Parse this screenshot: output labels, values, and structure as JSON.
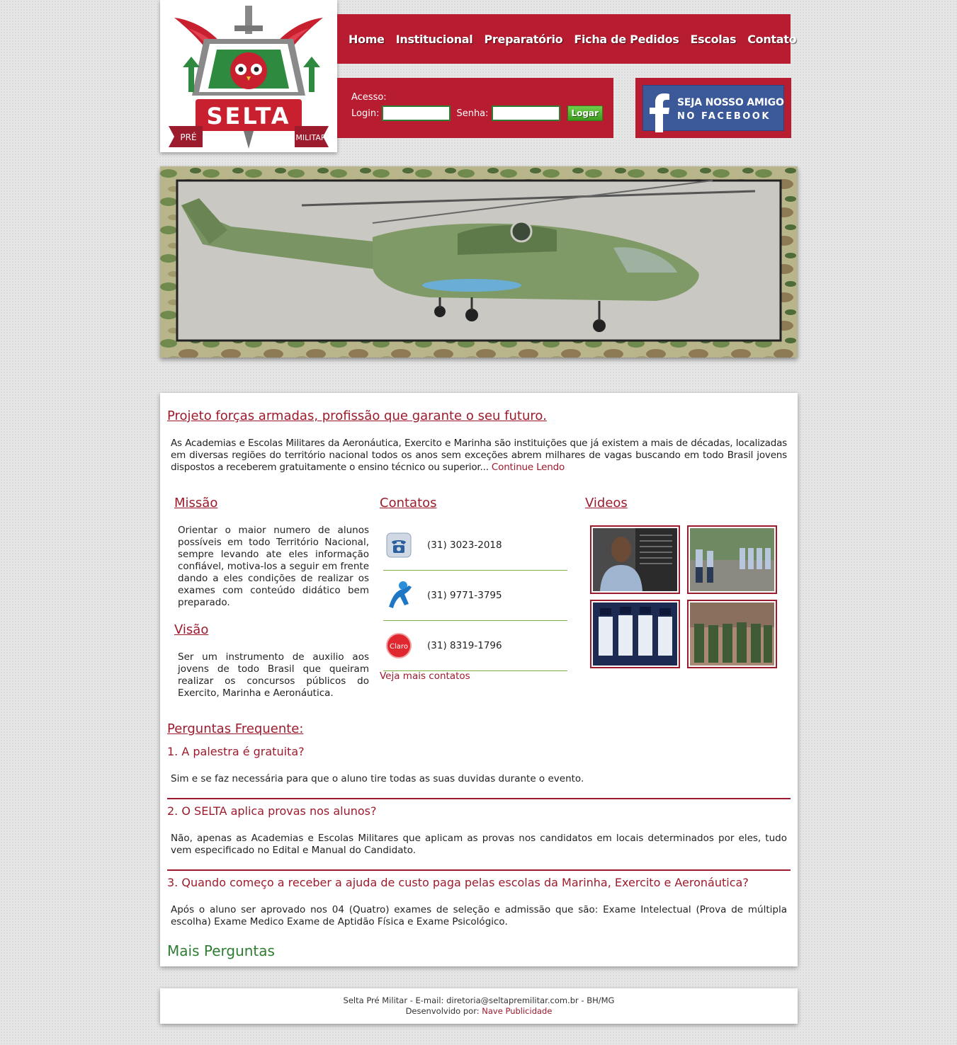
{
  "logo": {
    "brand_name": "SELTA",
    "ribbon_left": "PRÉ",
    "ribbon_right": "MILITAR"
  },
  "nav": {
    "items": [
      "Home",
      "Institucional",
      "Preparatório",
      "Ficha de Pedidos",
      "Escolas",
      "Contato"
    ]
  },
  "login": {
    "title": "Acesso:",
    "login_label": "Login:",
    "password_label": "Senha:",
    "button_label": "Logar",
    "login_value": "",
    "password_value": ""
  },
  "facebook": {
    "line1": "SEJA NOSSO AMIGO",
    "line2": "NO FACEBOOK"
  },
  "intro": {
    "title": "Projeto forças armadas, profissão que garante o seu futuro.",
    "text": "As Academias e Escolas Militares da Aeronáutica, Exercito e Marinha são instituições que já existem a mais de décadas, localizadas em diversas regiões do território nacional todos os anos sem exceções abrem milhares de vagas buscando em todo Brasil jovens dispostos a receberem gratuitamente o ensino técnico ou superior...",
    "continue_link": "Continue Lendo"
  },
  "missao": {
    "title": "Missão",
    "text": "Orientar o maior numero de alunos possíveis em todo Território Nacional, sempre levando ate eles informação confiável, motiva-los a seguir em frente dando a eles condições de realizar os exames com conteúdo didático bem preparado."
  },
  "visao": {
    "title": "Visão",
    "text": "Ser um instrumento de auxilio aos jovens de todo Brasil que queiram realizar os concursos públicos do Exercito, Marinha e Aeronáutica."
  },
  "contatos": {
    "title": "Contatos",
    "items": [
      {
        "icon": "telephone-icon",
        "number": "(31) 3023-2018"
      },
      {
        "icon": "vivo-operator-icon",
        "number": "(31) 9771-3795"
      },
      {
        "icon": "claro-operator-icon",
        "number": "(31) 8319-1796",
        "icon_text": "Claro"
      }
    ],
    "more_link": "Veja mais contatos"
  },
  "videos": {
    "title": "Videos",
    "thumbnails": [
      "video-thumb-officer",
      "video-thumb-cadets-formation",
      "video-thumb-navy-salute",
      "video-thumb-army-troops"
    ]
  },
  "faq": {
    "title": "Perguntas Frequente:",
    "items": [
      {
        "question": "1. A palestra é gratuita?",
        "answer": "Sim e se faz necessária para que o aluno tire todas as suas duvidas durante o evento."
      },
      {
        "question": "2. O SELTA aplica provas nos alunos?",
        "answer": "Não, apenas as Academias e Escolas Militares que aplicam as provas nos candidatos em locais determinados por eles, tudo vem especificado no Edital e Manual do Candidato."
      },
      {
        "question": "3. Quando começo a receber a ajuda de custo paga pelas escolas da Marinha, Exercito e Aeronáutica?",
        "answer": "Após o aluno ser aprovado nos 04 (Quatro) exames de seleção e admissão que são: Exame Intelectual (Prova de múltipla escolha) Exame Medico Exame de Aptidão Física e Exame Psicológico."
      }
    ],
    "more_link": "Mais Perguntas"
  },
  "footer": {
    "line1": "Selta Pré Militar - E-mail: diretoria@seltapremilitar.com.br - BH/MG",
    "line2_prefix": "Desenvolvido por:",
    "line2_link": "Nave Publicidade"
  },
  "colors": {
    "brand_red": "#b81c30",
    "heading_red": "#9c1b2c",
    "green": "#2e7d32",
    "facebook_blue": "#3b5998"
  }
}
